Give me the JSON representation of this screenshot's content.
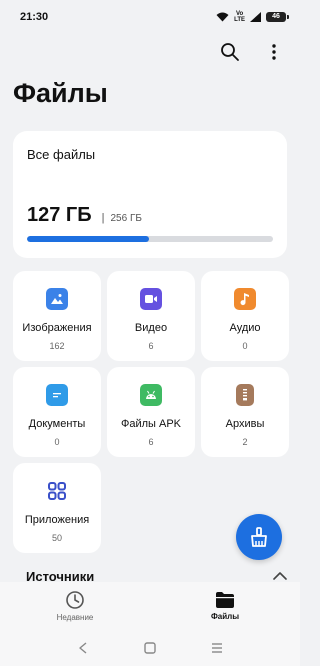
{
  "status_bar": {
    "time": "21:30",
    "volte_top": "Vo",
    "volte_bottom": "LTE",
    "battery": "46"
  },
  "header": {
    "title": "Файлы",
    "icons": [
      "search-icon",
      "more-vert-icon"
    ]
  },
  "storage": {
    "title": "Все файлы",
    "used": "127 ГБ",
    "separator": "|",
    "total": "256 ГБ",
    "used_fraction": 0.496
  },
  "categories": [
    {
      "label": "Изображения",
      "count": "162",
      "icon": "image-icon",
      "color": "#3b82e8"
    },
    {
      "label": "Видео",
      "count": "6",
      "icon": "video-icon",
      "color": "#6551e0"
    },
    {
      "label": "Аудио",
      "count": "0",
      "icon": "music-icon",
      "color": "#f08a2e"
    },
    {
      "label": "Документы",
      "count": "0",
      "icon": "document-icon",
      "color": "#2f9be8"
    },
    {
      "label": "Файлы APK",
      "count": "6",
      "icon": "android-icon",
      "color": "#3fba63"
    },
    {
      "label": "Архивы",
      "count": "2",
      "icon": "archive-icon",
      "color": "#a57a5c"
    },
    {
      "label": "Приложения",
      "count": "50",
      "icon": "apps-grid-icon",
      "color": "#3a50c9"
    }
  ],
  "sources": {
    "title": "Источники"
  },
  "bottom_nav": {
    "items": [
      {
        "label": "Недавние",
        "icon": "clock-icon",
        "active": false
      },
      {
        "label": "Файлы",
        "icon": "folder-icon",
        "active": true
      }
    ]
  },
  "colors": {
    "accent": "#1d6fe0",
    "background": "#f1f2f4",
    "card": "#ffffff"
  }
}
